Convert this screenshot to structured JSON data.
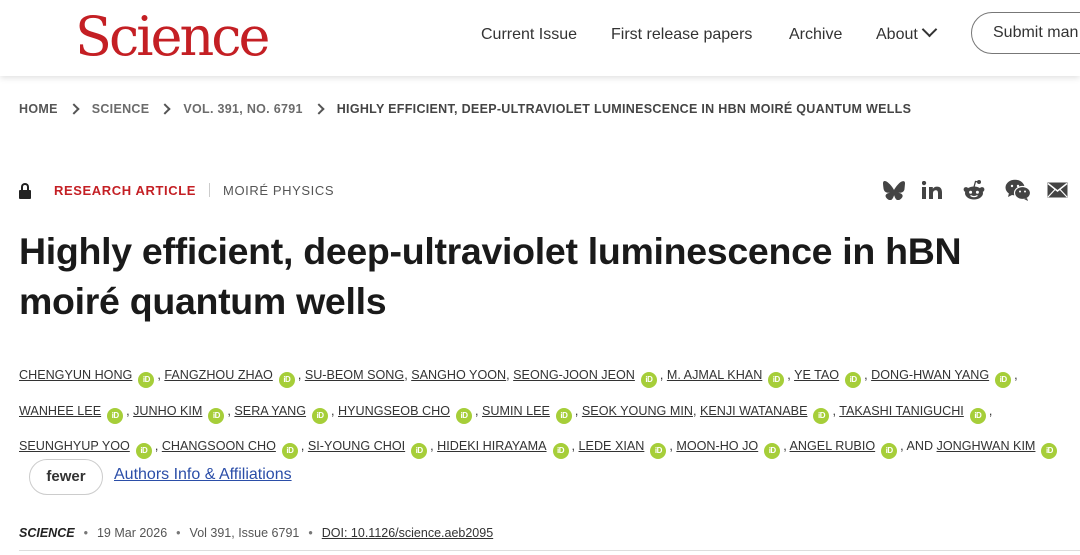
{
  "header": {
    "logo": "Science",
    "nav": [
      "Current Issue",
      "First release papers",
      "Archive",
      "About"
    ],
    "submit_label": "Submit man"
  },
  "breadcrumb": {
    "home": "HOME",
    "science": "SCIENCE",
    "issue": "VOL. 391, NO. 6791",
    "current": "HIGHLY EFFICIENT, DEEP-ULTRAVIOLET LUMINESCENCE IN HBN MOIRÉ QUANTUM WELLS"
  },
  "article": {
    "type": "RESEARCH ARTICLE",
    "subject": "MOIRÉ PHYSICS",
    "title": "Highly efficient, deep-ultraviolet luminescence in hBN moiré quantum wells"
  },
  "share_icons": [
    "bluesky-icon",
    "linkedin-icon",
    "reddit-icon",
    "wechat-icon",
    "email-icon"
  ],
  "authors": {
    "line1": [
      "CHENGYUN HONG",
      "FANGZHOU ZHAO",
      "SU-BEOM SONG",
      "SANGHO YOON",
      "SEONG-JOON JEON",
      "M. AJMAL KHAN",
      "YE TAO",
      "DONG-HWAN YANG"
    ],
    "line2": [
      "WANHEE LEE",
      "JUNHO KIM",
      "SERA YANG",
      "HYUNGSEOB CHO",
      "SUMIN LEE",
      "SEOK YOUNG MIN",
      "KENJI WATANABE",
      "TAKASHI TANIGUCHI"
    ],
    "line3": [
      "SEUNGHYUP YOO",
      "CHANGSOON CHO",
      "SI-YOUNG CHOI",
      "HIDEKI HIRAYAMA",
      "LEDE XIAN",
      "MOON-HO JO",
      "ANGEL RUBIO",
      "JONGHWAN KIM"
    ],
    "and_text": ", AND",
    "orcid_label": "iD",
    "comma": ","
  },
  "fewer_label": "fewer",
  "affiliations_label": "Authors Info & Affiliations",
  "citation": {
    "journal": "SCIENCE",
    "date": "19 Mar 2026",
    "volume": "Vol 391, Issue 6791",
    "doi": "DOI: 10.1126/science.aeb2095"
  },
  "colors": {
    "brand_red": "#c41f24",
    "orcid_green": "#a6ce39",
    "link_blue": "#2b4ea8"
  }
}
